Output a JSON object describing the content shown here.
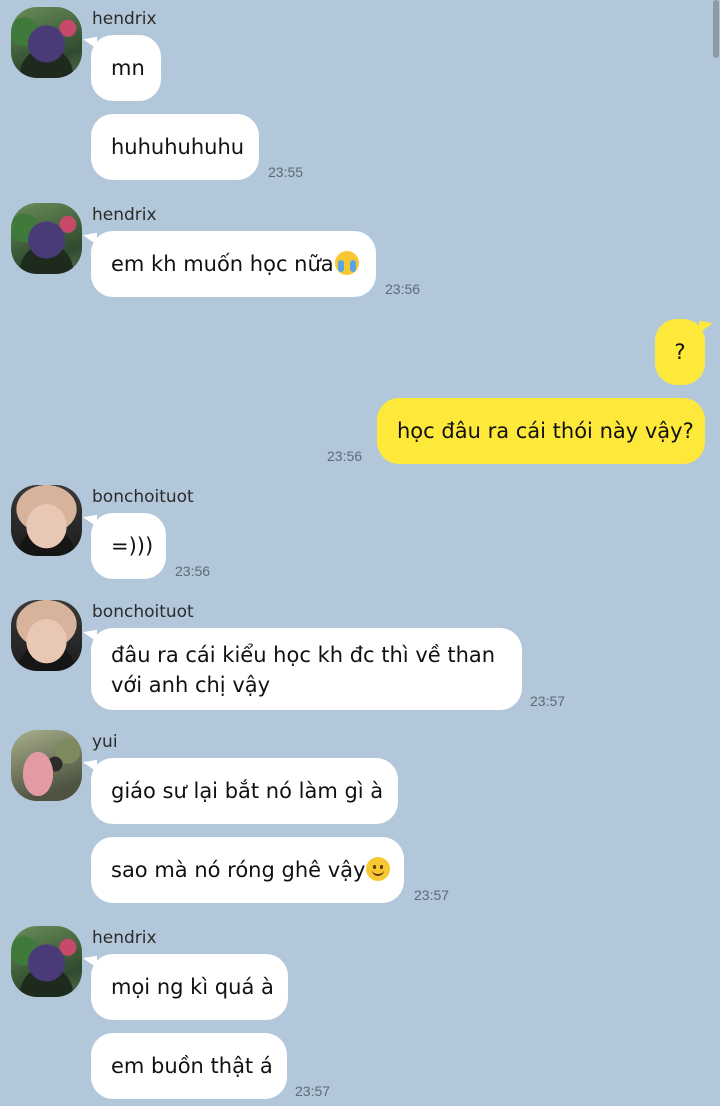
{
  "messages": [
    {
      "sender": "hendrix",
      "text": "mn",
      "time": ""
    },
    {
      "sender": "hendrix",
      "text": "huhuhuhuhu",
      "time": "23:55"
    },
    {
      "sender": "hendrix",
      "text": "em kh muốn học nữa",
      "emoji": "loudly-crying-face-icon",
      "time": "23:56"
    },
    {
      "sender": "me",
      "text": "?",
      "time": ""
    },
    {
      "sender": "me",
      "text": "học đâu ra cái thói này vậy?",
      "time": "23:56"
    },
    {
      "sender": "bonchoituot",
      "text": "=)))",
      "time": "23:56"
    },
    {
      "sender": "bonchoituot",
      "text": "đâu ra cái kiểu học kh đc thì về than với anh chị vậy",
      "time": "23:57"
    },
    {
      "sender": "yui",
      "text": "giáo sư lại bắt nó làm gì à",
      "time": ""
    },
    {
      "sender": "yui",
      "text": "sao mà nó róng ghê vậy",
      "emoji": "slightly-smiling-face-icon",
      "time": "23:57"
    },
    {
      "sender": "hendrix",
      "text": "mọi ng kì quá à",
      "time": ""
    },
    {
      "sender": "hendrix",
      "text": "em buồn thật á",
      "time": "23:57"
    }
  ],
  "colors": {
    "background": "#b2c7da",
    "incoming_bubble": "#ffffff",
    "outgoing_bubble": "#fee93b"
  }
}
